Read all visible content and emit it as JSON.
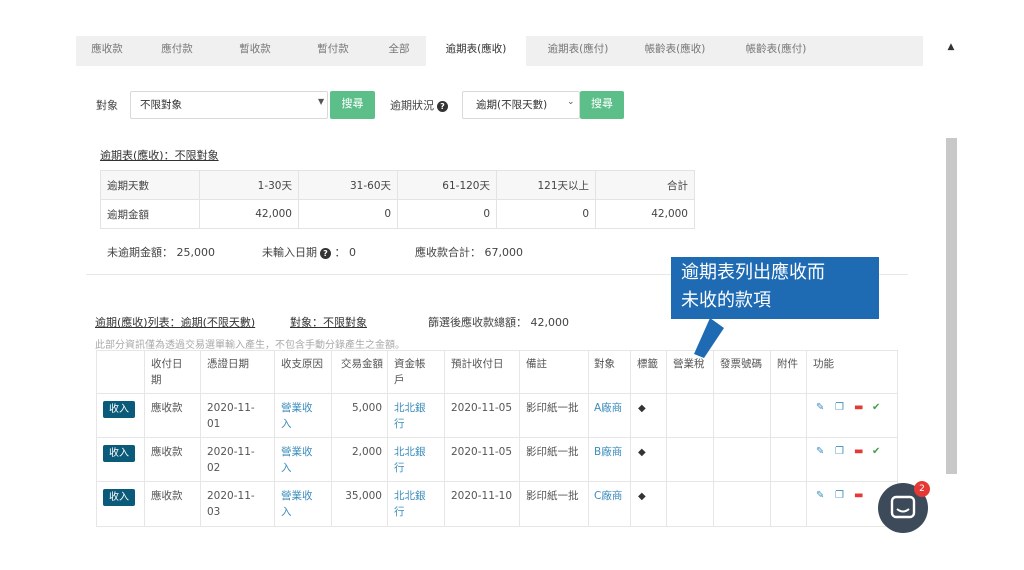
{
  "tabs": [
    "應收款",
    "應付款",
    "暫收款",
    "暫付款",
    "全部",
    "逾期表(應收)",
    "逾期表(應付)",
    "帳齡表(應收)",
    "帳齡表(應付)"
  ],
  "active_tab": "逾期表(應收)",
  "filters": {
    "target_label": "對象",
    "target_value": "不限對象",
    "search_label": "搜尋",
    "overdue_label": "逾期狀況",
    "overdue_value": "逾期(不限天數)",
    "search2_label": "搜尋"
  },
  "summary": {
    "title": "逾期表(應收)：不限對象",
    "header": [
      "逾期天數",
      "1-30天",
      "31-60天",
      "61-120天",
      "121天以上",
      "合計"
    ],
    "amounts": [
      "逾期金額",
      "42,000",
      "0",
      "0",
      "0",
      "42,000"
    ],
    "not_overdue": "未逾期金額： 25,000",
    "no_date_label": "未輸入日期",
    "no_date_value": "： 0",
    "total": "應收款合計： 67,000"
  },
  "list": {
    "title": "逾期(應收)列表：逾期(不限天數)",
    "target": "對象：不限對象",
    "filtered_total": "篩選後應收款總額： 42,000",
    "note": "此部分資訊僅為透過交易選單輸入產生，不包含手動分錄產生之金額。",
    "columns": [
      "收付日期",
      "憑證日期",
      "收支原因",
      "交易金額",
      "資金帳戶",
      "預計收付日",
      "備註",
      "對象",
      "標籤",
      "營業稅",
      "發票號碼",
      "附件",
      "功能"
    ],
    "rows": [
      {
        "badge": "收入",
        "type": "應收款",
        "voucher_date": "2020-11-01",
        "reason": "營業收入",
        "amount": "5,000",
        "account": "北北銀行",
        "expected": "2020-11-05",
        "remark": "影印紙一批",
        "target": "A廠商"
      },
      {
        "badge": "收入",
        "type": "應收款",
        "voucher_date": "2020-11-02",
        "reason": "營業收入",
        "amount": "2,000",
        "account": "北北銀行",
        "expected": "2020-11-05",
        "remark": "影印紙一批",
        "target": "B廠商"
      },
      {
        "badge": "收入",
        "type": "應收款",
        "voucher_date": "2020-11-03",
        "reason": "營業收入",
        "amount": "35,000",
        "account": "北北銀行",
        "expected": "2020-11-10",
        "remark": "影印紙一批",
        "target": "C廠商"
      }
    ]
  },
  "callout": {
    "line1": "逾期表列出應收而",
    "line2": "未收的款項"
  },
  "chat": {
    "badge": "2"
  },
  "icons": {
    "tag": "tag-icon",
    "edit": "edit-icon",
    "copy": "copy-icon",
    "delete": "trash-icon",
    "confirm": "check-circle-icon",
    "help": "question-circle-icon"
  },
  "colors": {
    "accent_green": "#5cbf8a",
    "badge_blue": "#0b5a7a",
    "link": "#3c8dbc",
    "callout": "#1e6bb4",
    "delete": "#e53935",
    "confirm": "#43a047"
  }
}
